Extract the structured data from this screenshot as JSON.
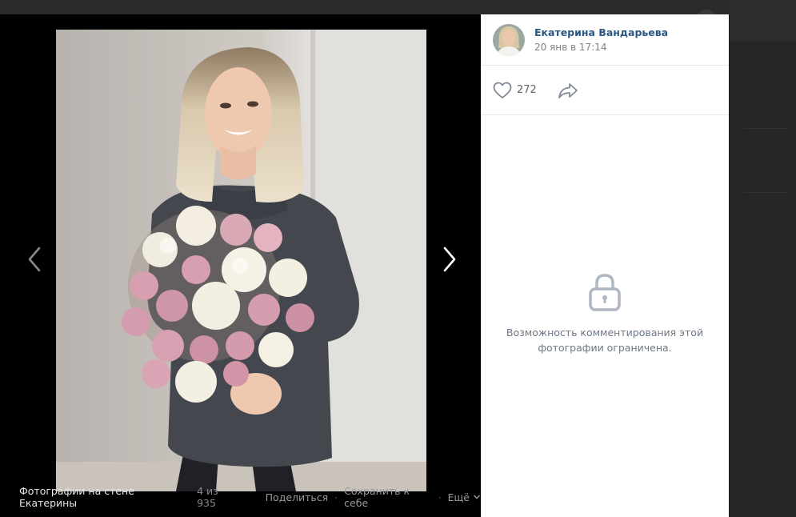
{
  "author": {
    "name": "Екатерина Вандарьева",
    "date": "20 янв в 17:14"
  },
  "likes": {
    "count": "272"
  },
  "comments": {
    "closed_line1": "Возможность комментирования этой",
    "closed_line2": "фотографии ограничена."
  },
  "bottom_bar": {
    "album_title": "Фотографии на стене Екатерины",
    "counter": "4 из 935",
    "share_label": "Поделиться",
    "separator": "·",
    "save_label": "Сохранить к себе",
    "more_label": "Ещё"
  },
  "icons": {
    "prev": "chevron-left-icon",
    "next": "chevron-right-icon",
    "like": "heart-icon",
    "share": "share-arrow-icon",
    "lock": "lock-icon",
    "more": "chevron-down-icon"
  },
  "colors": {
    "accent_link": "#2a5885",
    "viewer_bg": "#000000",
    "muted_text": "#6d7885"
  }
}
